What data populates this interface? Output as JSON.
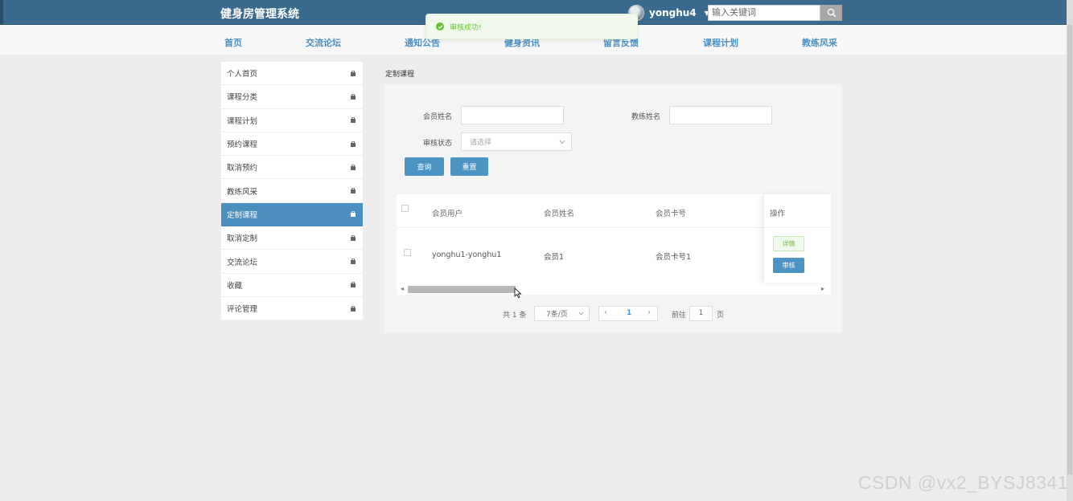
{
  "header": {
    "site_title": "健身房管理系统",
    "username": "yonghu4",
    "search_placeholder": "输入关键词"
  },
  "nav": [
    {
      "label": "首页"
    },
    {
      "label": "交流论坛"
    },
    {
      "label": "通知公告"
    },
    {
      "label": "健身资讯"
    },
    {
      "label": "留言反馈"
    },
    {
      "label": "课程计划"
    },
    {
      "label": "教练风采"
    }
  ],
  "toast": {
    "message": "审核成功!"
  },
  "sidebar": {
    "items": [
      {
        "label": "个人首页"
      },
      {
        "label": "课程分类"
      },
      {
        "label": "课程计划"
      },
      {
        "label": "预约课程"
      },
      {
        "label": "取消预约"
      },
      {
        "label": "教练风采"
      },
      {
        "label": "定制课程"
      },
      {
        "label": "取消定制"
      },
      {
        "label": "交流论坛"
      },
      {
        "label": "收藏"
      },
      {
        "label": "评论管理"
      }
    ],
    "active": "定制课程"
  },
  "main": {
    "heading": "定制课程",
    "filters": {
      "member_name_label": "会员姓名",
      "member_name_value": "",
      "coach_name_label": "教练姓名",
      "coach_name_value": "",
      "status_label": "审核状态",
      "status_placeholder": "请选择",
      "query_button": "查询",
      "reset_button": "重置"
    },
    "table": {
      "columns": [
        "会员用户",
        "会员姓名",
        "会员卡号",
        "操作"
      ],
      "rows": [
        {
          "user": "yonghu1-yonghu1",
          "name": "会员1",
          "card": "会员卡号1"
        }
      ],
      "detail_button": "详情",
      "audit_button": "审核"
    },
    "pagination": {
      "total_text": "共 1 条",
      "page_size": "7条/页",
      "current_page": "1",
      "goto_label": "前往",
      "goto_value": "1",
      "goto_suffix": "页"
    }
  },
  "watermark": "CSDN @vx2_BYSJ8341",
  "colors": {
    "topbar": "#3a6b8e",
    "accent": "#4d93c3",
    "success": "#67c23a"
  }
}
